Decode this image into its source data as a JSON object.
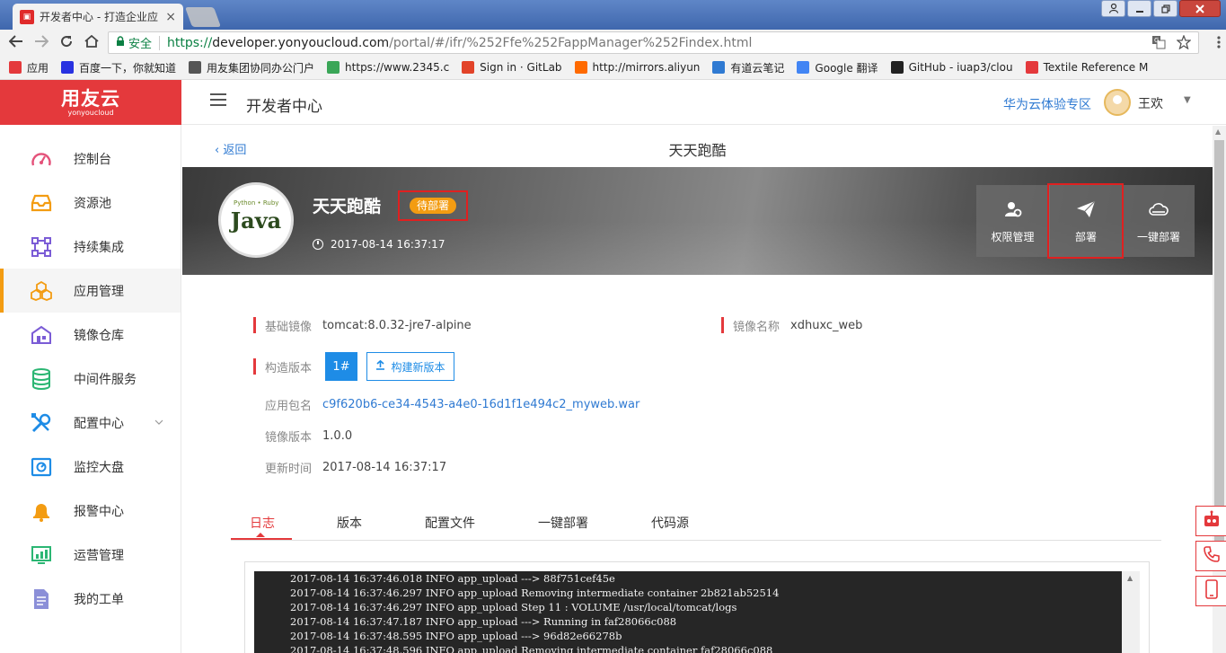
{
  "browser": {
    "tab_title": "开发者中心 - 打造企业应",
    "tab_close": "×",
    "secure_label": "安全",
    "url_scheme": "https://",
    "url_host": "developer.yonyoucloud.com",
    "url_rest": "/portal/#/ifr/%252Ffe%252FappManager%252Findex.html",
    "bookmarks": [
      {
        "label": "应用",
        "icon": "apps-grid-icon",
        "color": "#e4393c"
      },
      {
        "label": "百度一下，你就知道",
        "icon": "baidu-paw-icon",
        "color": "#2932e1"
      },
      {
        "label": "用友集团协同办公门户",
        "icon": "document-icon",
        "color": "#555555"
      },
      {
        "label": "https://www.2345.c",
        "icon": "2345-icon",
        "color": "#3aa657"
      },
      {
        "label": "Sign in · GitLab",
        "icon": "gitlab-fox-icon",
        "color": "#e24329"
      },
      {
        "label": "http://mirrors.aliyun",
        "icon": "aliyun-icon",
        "color": "#ff6a00"
      },
      {
        "label": "有道云笔记",
        "icon": "youdao-note-icon",
        "color": "#2f7ad2"
      },
      {
        "label": "Google 翻译",
        "icon": "google-translate-icon",
        "color": "#4285f4"
      },
      {
        "label": "GitHub - iuap3/clou",
        "icon": "github-icon",
        "color": "#222222"
      },
      {
        "label": "Textile Reference M",
        "icon": "textile-icon",
        "color": "#e4393c"
      }
    ]
  },
  "header": {
    "logo_main": "用友云",
    "logo_sub": "yonyoucloud",
    "title": "开发者中心",
    "huawei_link": "华为云体验专区",
    "username": "王欢"
  },
  "sidebar": {
    "items": [
      {
        "label": "控制台",
        "icon": "dashboard-gauge-icon"
      },
      {
        "label": "资源池",
        "icon": "inbox-tray-icon"
      },
      {
        "label": "持续集成",
        "icon": "integration-nodes-icon"
      },
      {
        "label": "应用管理",
        "icon": "cubes-icon"
      },
      {
        "label": "镜像仓库",
        "icon": "warehouse-icon"
      },
      {
        "label": "中间件服务",
        "icon": "database-icon"
      },
      {
        "label": "配置中心",
        "icon": "tools-icon"
      },
      {
        "label": "监控大盘",
        "icon": "monitor-icon"
      },
      {
        "label": "报警中心",
        "icon": "bell-icon"
      },
      {
        "label": "运营管理",
        "icon": "chart-screen-icon"
      },
      {
        "label": "我的工单",
        "icon": "ticket-doc-icon"
      }
    ],
    "active_index": 3,
    "colors": {
      "accent": "#f39c12",
      "pink": "#e4527a",
      "purple": "#7b5cd6",
      "green": "#2bb673",
      "blue": "#1e8ce6",
      "red": "#e4393c"
    }
  },
  "page": {
    "back_label": "返回",
    "subtitle": "天天跑酷",
    "app_name": "天天跑酷",
    "status": "待部署",
    "created_time": "2017-08-14 16:37:17",
    "actions": [
      {
        "label": "权限管理",
        "icon": "user-settings-icon"
      },
      {
        "label": "部署",
        "icon": "paper-plane-icon"
      },
      {
        "label": "一键部署",
        "icon": "cloud-icon"
      }
    ]
  },
  "details": {
    "base_image_label": "基础镜像",
    "base_image_value": "tomcat:8.0.32-jre7-alpine",
    "image_name_label": "镜像名称",
    "image_name_value": "xdhuxc_web",
    "build_version_label": "构造版本",
    "build_version_value": "1#",
    "build_new_label": "构建新版本",
    "package_label": "应用包名",
    "package_value": "c9f620b6-ce34-4543-a4e0-16d1f1e494c2_myweb.war",
    "image_version_label": "镜像版本",
    "image_version_value": "1.0.0",
    "updated_label": "更新时间",
    "updated_value": "2017-08-14 16:37:17"
  },
  "tabs": [
    "日志",
    "版本",
    "配置文件",
    "一键部署",
    "代码源"
  ],
  "log_lines": [
    "2017-08-14 16:37:46.018 INFO app_upload ---> 88f751cef45e",
    "2017-08-14 16:37:46.297 INFO app_upload Removing intermediate container 2b821ab52514",
    "2017-08-14 16:37:46.297 INFO app_upload Step 11 : VOLUME /usr/local/tomcat/logs",
    "2017-08-14 16:37:47.187 INFO app_upload ---> Running in faf28066c088",
    "2017-08-14 16:37:48.595 INFO app_upload ---> 96d82e66278b",
    "2017-08-14 16:37:48.596 INFO app_upload Removing intermediate container faf28066c088"
  ],
  "floating": [
    {
      "icon": "robot-icon"
    },
    {
      "icon": "phone-call-icon"
    },
    {
      "icon": "mobile-device-icon"
    }
  ]
}
